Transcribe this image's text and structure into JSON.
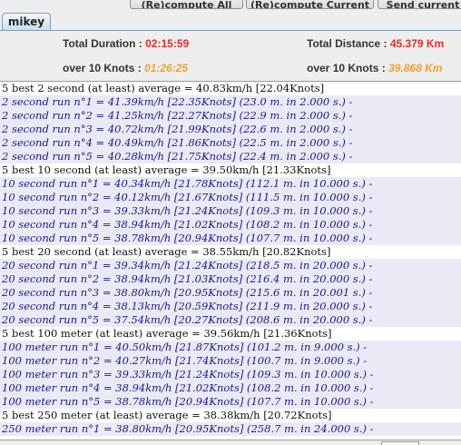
{
  "toolbar": {
    "recompute_all": "(Re)compute All",
    "recompute_current": "(Re)compute Current",
    "send_current": "Send current"
  },
  "tabs": [
    {
      "label": "mikey"
    }
  ],
  "summary": {
    "total_duration_label": "Total Duration :",
    "total_duration_value": "02:15:59",
    "total_distance_label": "Total Distance :",
    "total_distance_value": "45.379 Km",
    "over_duration_label": "over",
    "over_duration_knots": "10 Knots :",
    "over_duration_value": "01:26:25",
    "over_distance_label": "over",
    "over_distance_knots": "10 Knots :",
    "over_distance_value": "39.868 Km"
  },
  "results": [
    {
      "type": "header",
      "text": "5 best 2 second (at least) average = 40.83km/h [22.04Knots]"
    },
    {
      "type": "run",
      "text": "2 second run n°1 = 41.39km/h [22.35Knots] (23.0 m. in 2.000 s.) -"
    },
    {
      "type": "run",
      "text": "2 second run n°2 = 41.25km/h [22.27Knots] (22.9 m. in 2.000 s.) -"
    },
    {
      "type": "run",
      "text": "2 second run n°3 = 40.72km/h [21.99Knots] (22.6 m. in 2.000 s.) -"
    },
    {
      "type": "run",
      "text": "2 second run n°4 = 40.49km/h [21.86Knots] (22.5 m. in 2.000 s.) -"
    },
    {
      "type": "run",
      "text": "2 second run n°5 = 40.28km/h [21.75Knots] (22.4 m. in 2.000 s.) -"
    },
    {
      "type": "header",
      "text": "5 best 10 second (at least) average = 39.50km/h [21.33Knots]"
    },
    {
      "type": "run",
      "text": "10 second run n°1 = 40.34km/h [21.78Knots] (112.1 m. in 10.000 s.) -"
    },
    {
      "type": "run",
      "text": "10 second run n°2 = 40.12km/h [21.67Knots] (111.5 m. in 10.000 s.) -"
    },
    {
      "type": "run",
      "text": "10 second run n°3 = 39.33km/h [21.24Knots] (109.3 m. in 10.000 s.) -"
    },
    {
      "type": "run",
      "text": "10 second run n°4 = 38.94km/h [21.02Knots] (108.2 m. in 10.000 s.) -"
    },
    {
      "type": "run",
      "text": "10 second run n°5 = 38.78km/h [20.94Knots] (107.7 m. in 10.000 s.) -"
    },
    {
      "type": "header",
      "text": "5 best 20 second (at least) average = 38.55km/h [20.82Knots]"
    },
    {
      "type": "run",
      "text": "20 second run n°1 = 39.34km/h [21.24Knots] (218.5 m. in 20.000 s.) -"
    },
    {
      "type": "run",
      "text": "20 second run n°2 = 38.94km/h [21.03Knots] (216.4 m. in 20.000 s.) -"
    },
    {
      "type": "run",
      "text": "20 second run n°3 = 38.80km/h [20.95Knots] (215.6 m. in 20.001 s.) -"
    },
    {
      "type": "run",
      "text": "20 second run n°4 = 38.13km/h [20.59Knots] (211.9 m. in 20.000 s.) -"
    },
    {
      "type": "run",
      "text": "20 second run n°5 = 37.54km/h [20.27Knots] (208.6 m. in 20.000 s.) -"
    },
    {
      "type": "header",
      "text": "5 best 100 meter (at least) average = 39.56km/h [21.36Knots]"
    },
    {
      "type": "run",
      "text": "100 meter run n°1 = 40.50km/h [21.87Knots] (101.2 m. in 9.000 s.) -"
    },
    {
      "type": "run",
      "text": "100 meter run n°2 = 40.27km/h [21.74Knots] (100.7 m. in 9.000 s.) -"
    },
    {
      "type": "run",
      "text": "100 meter run n°3 = 39.33km/h [21.24Knots] (109.3 m. in 10.000 s.) -"
    },
    {
      "type": "run",
      "text": "100 meter run n°4 = 38.94km/h [21.02Knots] (108.2 m. in 10.000 s.) -"
    },
    {
      "type": "run",
      "text": "100 meter run n°5 = 38.78km/h [20.94Knots] (107.7 m. in 10.000 s.) -"
    },
    {
      "type": "header",
      "text": "5 best 250 meter (at least) average = 38.38km/h [20.72Knots]"
    },
    {
      "type": "run",
      "text": "250 meter run n°1 = 38.80km/h [20.95Knots] (258.7 m. in 24.000 s.) -"
    }
  ]
}
